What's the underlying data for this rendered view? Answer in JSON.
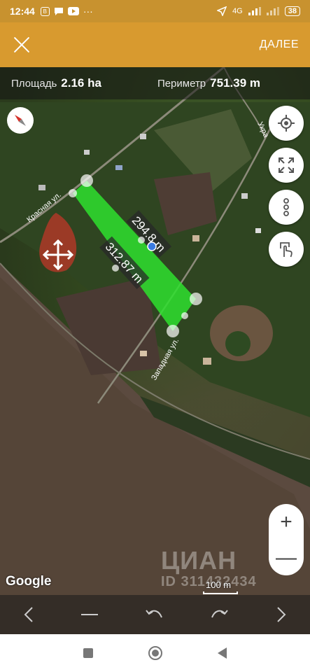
{
  "status_bar": {
    "time": "12:44",
    "notif_icons": [
      "vpn-icon",
      "chat-icon",
      "youtube-icon"
    ],
    "more": "···",
    "network": "4G",
    "battery": "38"
  },
  "toolbar": {
    "next_label": "ДАЛЕЕ",
    "accent_color": "#d89a2f"
  },
  "measure": {
    "area_label": "Площадь",
    "area_value": "2.16 ha",
    "perimeter_label": "Периметр",
    "perimeter_value": "751.39 m"
  },
  "map": {
    "street_krasnaya": "Красная ул.",
    "street_zapadnaya": "Западная ул.",
    "street_ukr": "Укра",
    "side1_length": "294.8 m",
    "side2_length": "312.87 m",
    "polygon_color": "#2ee02e",
    "attribution": "Google",
    "scale_label": "100 m",
    "watermark_brand": "ЦИАН",
    "watermark_id": "ID 311432434"
  },
  "zoom": {
    "in": "+",
    "out": "—"
  },
  "side_buttons": [
    "locate-icon",
    "fullscreen-icon",
    "more-vertical-icon",
    "touch-icon"
  ]
}
